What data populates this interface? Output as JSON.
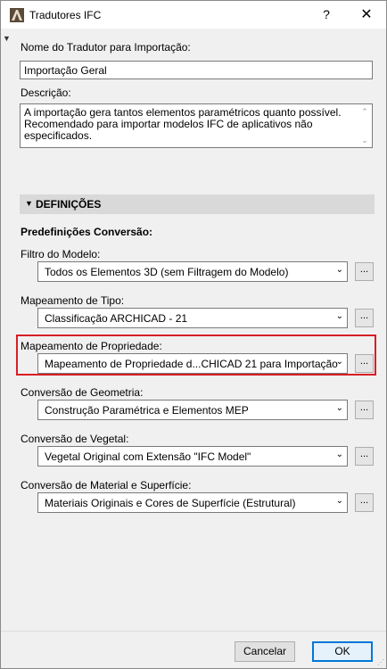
{
  "window": {
    "title": "Tradutores IFC",
    "help": "?",
    "close": "✕"
  },
  "name_field": {
    "label": "Nome do Tradutor para Importação:",
    "value": "Importação Geral"
  },
  "description": {
    "label": "Descrição:",
    "text": "A importação gera tantos elementos paramétricos quanto possível. Recomendado para importar modelos IFC de aplicativos não especificados."
  },
  "section": {
    "title": "DEFINIÇÕES"
  },
  "presets": {
    "heading": "Predefinições Conversão:"
  },
  "settings": [
    {
      "label": "Filtro do Modelo:",
      "value": "Todos os Elementos 3D (sem Filtragem do Modelo)",
      "button": "..."
    },
    {
      "label": "Mapeamento de Tipo:",
      "value": "Classificação ARCHICAD - 21",
      "button": "..."
    },
    {
      "label": "Mapeamento de Propriedade:",
      "value": "Mapeamento de Propriedade d...CHICAD 21 para Importação",
      "button": "..."
    },
    {
      "label": "Conversão de Geometria:",
      "value": "Construção Paramétrica e Elementos MEP",
      "button": "..."
    },
    {
      "label": "Conversão de Vegetal:",
      "value": "Vegetal Original com Extensão \"IFC Model\"",
      "button": "..."
    },
    {
      "label": "Conversão de Material e Superfície:",
      "value": "Materiais Originais e Cores de Superfície (Estrutural)",
      "button": "..."
    }
  ],
  "buttons": {
    "cancel": "Cancelar",
    "ok": "OK"
  },
  "colors": {
    "highlight": "#d71f26",
    "ok_border": "#0078d7"
  }
}
